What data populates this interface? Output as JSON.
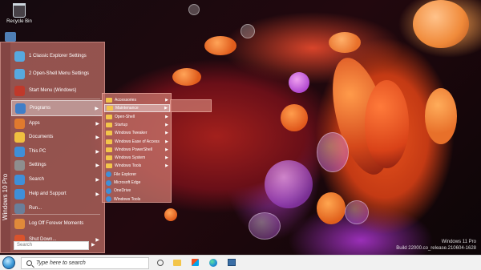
{
  "desktop": {
    "recycle_bin_label": "Recycle Bin",
    "watermark_line1": "Windows 11 Pro",
    "watermark_line2": "Build 22000.co_release.210604-1628"
  },
  "start_menu": {
    "side_label": "Windows 10 Pro",
    "items": [
      {
        "label": "1 Classic Explorer Settings",
        "icon": "settings-shell-icon",
        "color": "#57a9df"
      },
      {
        "label": "2 Open-Shell Menu Settings",
        "icon": "settings-shell-icon",
        "color": "#57a9df"
      },
      {
        "label": "Start Menu (Windows)",
        "icon": "windows-logo-icon",
        "color": "#c0392b"
      },
      {
        "label": "Programs",
        "icon": "programs-folder-icon",
        "color": "#3f7ec8",
        "highlighted": true
      },
      {
        "label": "Apps",
        "icon": "apps-icon",
        "color": "#e07a2e"
      },
      {
        "label": "Documents",
        "icon": "documents-icon",
        "color": "#f0c040"
      },
      {
        "label": "This PC",
        "icon": "computer-icon",
        "color": "#3f8fd8"
      },
      {
        "label": "Settings",
        "icon": "gear-icon",
        "color": "#8e8e8e"
      },
      {
        "label": "Search",
        "icon": "search-icon",
        "color": "#3f8fd8"
      },
      {
        "label": "Help and Support",
        "icon": "help-icon",
        "color": "#3f8fd8"
      },
      {
        "label": "Run...",
        "icon": "run-icon",
        "color": "#6a7f9a"
      },
      {
        "label": "Log Off Forever Moments",
        "icon": "log-off-icon",
        "color": "#e08a3a"
      },
      {
        "label": "Shut Down...",
        "icon": "power-icon",
        "color": "#d9532c"
      }
    ],
    "search_placeholder": "Search",
    "power_arrow": "▶"
  },
  "programs_menu": {
    "items": [
      {
        "label": "Accessories",
        "type": "folder",
        "submenu": true
      },
      {
        "label": "Maintenance",
        "type": "folder",
        "submenu": true,
        "highlighted": true
      },
      {
        "label": "Open-Shell",
        "type": "folder",
        "submenu": true
      },
      {
        "label": "Startup",
        "type": "folder",
        "submenu": true
      },
      {
        "label": "Windows Tweaker",
        "type": "folder",
        "submenu": true
      },
      {
        "label": "Windows Ease of Access",
        "type": "folder",
        "submenu": true
      },
      {
        "label": "Windows PowerShell",
        "type": "folder",
        "submenu": true
      },
      {
        "label": "Windows System",
        "type": "folder",
        "submenu": true
      },
      {
        "label": "Windows Tools",
        "type": "folder",
        "submenu": true
      },
      {
        "label": "File Explorer",
        "type": "app"
      },
      {
        "label": "Microsoft Edge",
        "type": "app"
      },
      {
        "label": "OneDrive",
        "type": "app"
      },
      {
        "label": "Windows Tools",
        "type": "app"
      }
    ]
  },
  "taskbar": {
    "search_placeholder": "Type here to search"
  }
}
